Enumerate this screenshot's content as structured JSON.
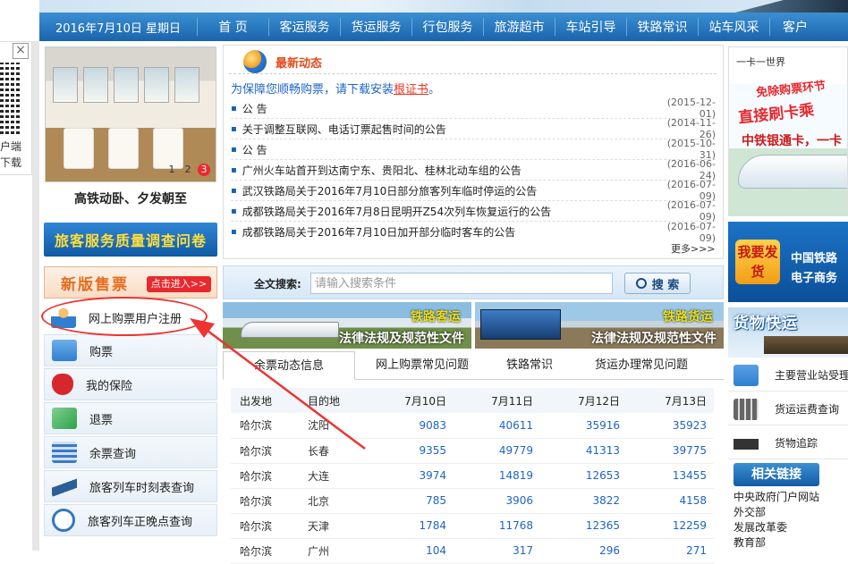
{
  "nav": {
    "date": "2016年7月10日 星期日",
    "items": [
      "首 页",
      "客运服务",
      "货运服务",
      "行包服务",
      "旅游超市",
      "车站引导",
      "铁路常识",
      "站车风采",
      "客户"
    ]
  },
  "qr": {
    "close": "×",
    "line1": "户端",
    "line2": "下载"
  },
  "slideshow": {
    "caption": "高铁动卧、夕发朝至",
    "pages": [
      "1",
      "2",
      "3"
    ],
    "active_page": 3
  },
  "survey_button": "旅客服务质量调查问卷",
  "new_ticket": {
    "title": "新版售票",
    "enter": "点击进入>>"
  },
  "left_menu": [
    {
      "label": "网上购票用户注册",
      "icon": "user-register-icon",
      "color": "#f0a020"
    },
    {
      "label": "购票",
      "icon": "ticket-buy-icon",
      "color": "#2f7fd0"
    },
    {
      "label": "我的保险",
      "icon": "insurance-shield-icon",
      "color": "#d6282c"
    },
    {
      "label": "退票",
      "icon": "refund-arrow-icon",
      "color": "#2fa04a"
    },
    {
      "label": "余票查询",
      "icon": "remaining-tickets-icon",
      "color": "#3a7ac8"
    },
    {
      "label": "旅客列车时刻表查询",
      "icon": "train-timetable-icon",
      "color": "#2a5f9a"
    },
    {
      "label": "旅客列车正晚点查询",
      "icon": "clock-icon",
      "color": "#3377c0"
    }
  ],
  "news": {
    "title": "最新动态",
    "notice_prefix": "为保障您顺畅购票，请下载安装",
    "notice_link": "根证书",
    "notice_suffix": "。",
    "items": [
      {
        "title": "公 告",
        "date": "(2015-12-01)"
      },
      {
        "title": "关于调整互联网、电话订票起售时间的公告",
        "date": "(2014-11-26)"
      },
      {
        "title": "公 告",
        "date": "(2015-10-31)"
      },
      {
        "title": "广州火车站首开到达南宁东、贵阳北、桂林北动车组的公告",
        "date": "(2016-06-24)"
      },
      {
        "title": "武汉铁路局关于2016年7月10日部分旅客列车临时停运的公告",
        "date": "(2016-07-09)"
      },
      {
        "title": "成都铁路局关于2016年7月8日昆明开Z54次列车恢复运行的公告",
        "date": "(2016-07-09)"
      },
      {
        "title": "成都铁路局关于2016年7月10日加开部分临时客车的公告",
        "date": "(2016-07-09)"
      }
    ],
    "more": "更多>>>"
  },
  "search": {
    "label": "全文搜索:",
    "placeholder": "请输入搜索条件",
    "button": "搜 索"
  },
  "banners": [
    {
      "tag": "铁路客运",
      "subtitle": "法律法规及规范性文件"
    },
    {
      "tag": "铁路货运",
      "subtitle": "法律法规及规范性文件"
    }
  ],
  "tabs": [
    "余票动态信息",
    "网上购票常见问题",
    "铁路常识",
    "货运办理常见问题"
  ],
  "ticket_table": {
    "headers": [
      "出发地",
      "目的地",
      "7月10日",
      "7月11日",
      "7月12日",
      "7月13日"
    ],
    "rows": [
      [
        "哈尔滨",
        "沈阳",
        "9083",
        "40611",
        "35916",
        "35923"
      ],
      [
        "哈尔滨",
        "长春",
        "9355",
        "49779",
        "41313",
        "39775"
      ],
      [
        "哈尔滨",
        "大连",
        "3974",
        "14819",
        "12653",
        "13455"
      ],
      [
        "哈尔滨",
        "北京",
        "785",
        "3906",
        "3822",
        "4158"
      ],
      [
        "哈尔滨",
        "天津",
        "1784",
        "11768",
        "12365",
        "12259"
      ],
      [
        "哈尔滨",
        "广州",
        "104",
        "317",
        "296",
        "271"
      ]
    ]
  },
  "right_ads": {
    "card_logo": "一卡一世界",
    "card_slogan1": "免除购票环节",
    "card_slogan2": "直接刷卡乘",
    "card_slogan3": "中铁银通卡，一卡",
    "ship_badge": "我要发货",
    "ship_line1": "中国铁路",
    "ship_line2": "电子商务",
    "freight_express": "货物快运"
  },
  "right_links": [
    {
      "label": "主要营业站受理",
      "icon": "phone-icon",
      "color": "#2f7fd0"
    },
    {
      "label": "货运运费查询",
      "icon": "calculator-icon",
      "color": "#666666"
    },
    {
      "label": "货物追踪",
      "icon": "freight-train-icon",
      "color": "#333333"
    }
  ],
  "related": {
    "title": "相关链接",
    "items": [
      "中央政府门户网站",
      "外交部",
      "发展改革委",
      "教育部"
    ]
  }
}
